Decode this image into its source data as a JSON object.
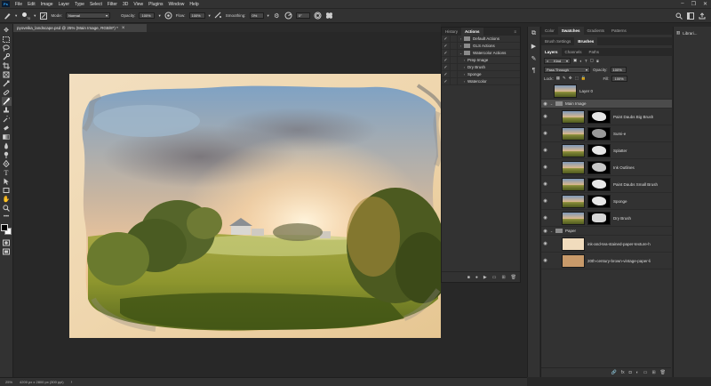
{
  "menubar": {
    "logo": "Ps",
    "items": [
      "File",
      "Edit",
      "Image",
      "Layer",
      "Type",
      "Select",
      "Filter",
      "3D",
      "View",
      "Plugins",
      "Window",
      "Help"
    ],
    "window_controls": [
      "–",
      "❐",
      "✕"
    ]
  },
  "options_bar": {
    "brush_size": "70",
    "mode_label": "Mode:",
    "mode_value": "Normal",
    "opacity_label": "Opacity:",
    "opacity_value": "100%",
    "flow_label": "Flow:",
    "flow_value": "100%",
    "smoothing_label": "Smoothing:",
    "smoothing_value": "0%",
    "angle_value": "0°"
  },
  "document": {
    "tab_title": "pyoveika_landscape.psd @ 25% (Main Image, RGB/8*) *",
    "close_glyph": "×"
  },
  "status_bar": {
    "zoom": "25%",
    "dimensions": "4200 px x 2800 px (300 ppi)"
  },
  "actions_panel": {
    "tabs": [
      "History",
      "Actions"
    ],
    "active_tab": "Actions",
    "rows": [
      {
        "label": "Default Actions",
        "type": "set",
        "expanded": false
      },
      {
        "label": "GLS Actions",
        "type": "set",
        "expanded": false
      },
      {
        "label": "Watercolor Actions",
        "type": "set",
        "expanded": true
      },
      {
        "label": "Prep Image",
        "type": "action"
      },
      {
        "label": "Dry Brush",
        "type": "action"
      },
      {
        "label": "Sponge",
        "type": "action"
      },
      {
        "label": "Watercolor",
        "type": "action"
      }
    ]
  },
  "top_panel": {
    "tabs": [
      "Color",
      "Swatches",
      "Gradients",
      "Patterns"
    ],
    "active_tab": "Swatches",
    "sub_tabs": [
      "Brush Settings",
      "Brushes"
    ],
    "active_sub_tab": "Brushes"
  },
  "layers_panel": {
    "tabs": [
      "Layers",
      "Channels",
      "Paths"
    ],
    "active_tab": "Layers",
    "filter_label": "Kind",
    "blend_mode": "Pass Through",
    "opacity_label": "Opacity:",
    "opacity_value": "100%",
    "lock_label": "Lock:",
    "fill_label": "Fill:",
    "fill_value": "100%",
    "layers": [
      {
        "name": "Layer 0",
        "kind": "layer",
        "thumb": "landscape",
        "mask": false,
        "visible": false
      },
      {
        "name": "Main Image",
        "kind": "group",
        "selected": true,
        "visible": true
      },
      {
        "name": "Paint Daubs Big Brush",
        "kind": "layer",
        "thumb": "landscape",
        "mask": true,
        "visible": true
      },
      {
        "name": "Sumi-e",
        "kind": "layer",
        "thumb": "landscape",
        "mask": true,
        "visible": true
      },
      {
        "name": "Splatter",
        "kind": "layer",
        "thumb": "landscape",
        "mask": true,
        "visible": true
      },
      {
        "name": "Ink Outlines",
        "kind": "layer",
        "thumb": "landscape",
        "mask": true,
        "visible": true
      },
      {
        "name": "Paint Daubs Small Brush",
        "kind": "layer",
        "thumb": "landscape",
        "mask": true,
        "visible": true
      },
      {
        "name": "Sponge",
        "kind": "layer",
        "thumb": "landscape",
        "mask": true,
        "visible": true
      },
      {
        "name": "Dry Brush",
        "kind": "layer",
        "thumb": "landscape",
        "mask": true,
        "visible": true
      },
      {
        "name": "Paper",
        "kind": "group",
        "selected": false,
        "visible": true
      },
      {
        "name": "ink-and-tea-stained-paper-texture-h",
        "kind": "layer",
        "thumb": "paper-light",
        "mask": false,
        "visible": true
      },
      {
        "name": "20th-century-brown-vintage-paper-li",
        "kind": "layer",
        "thumb": "paper-brown",
        "mask": false,
        "visible": true
      }
    ]
  },
  "libraries_panel": {
    "title": "Librari..."
  },
  "colors": {
    "accent": "#31a8ff",
    "panel_bg": "#323232",
    "canvas_bg": "#282828"
  }
}
